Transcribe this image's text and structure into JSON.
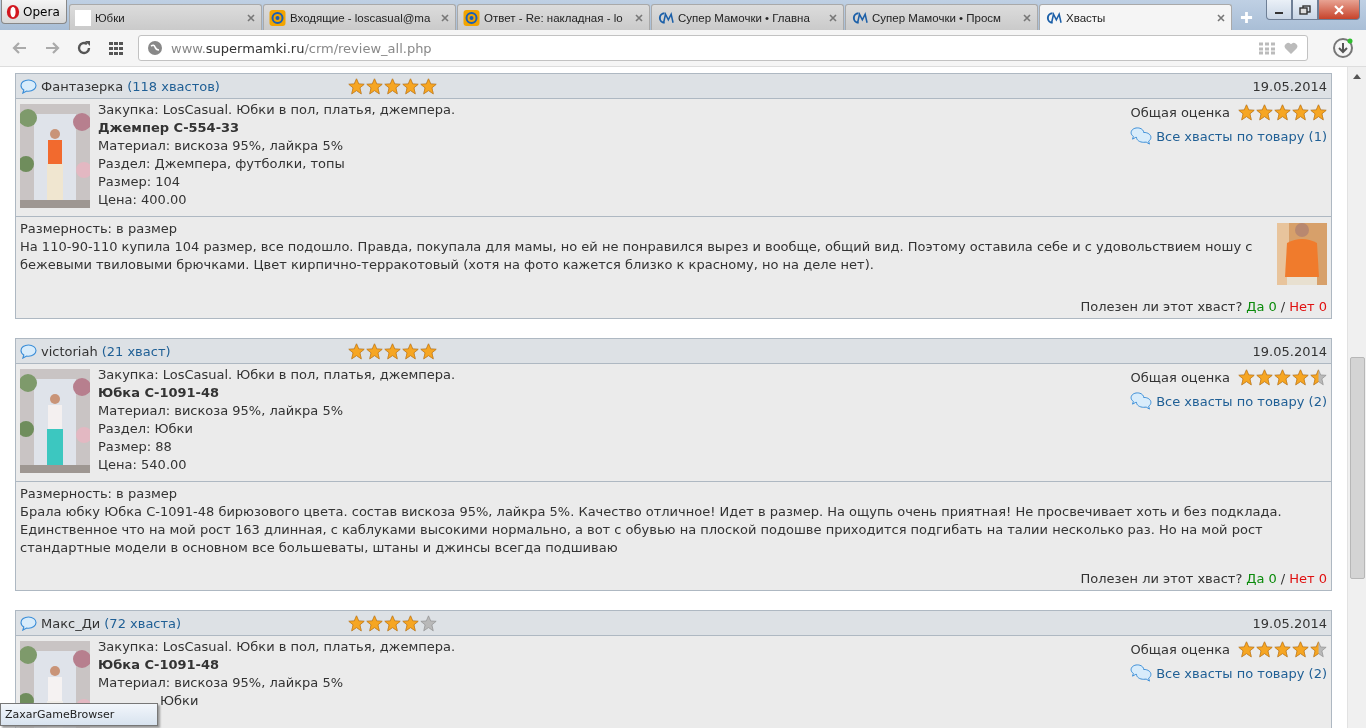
{
  "browser": {
    "menu_button": "Opera",
    "tabs": [
      {
        "title": "Юбки",
        "kind": "blank",
        "selected": false
      },
      {
        "title": "Входящие - loscasual@ma",
        "kind": "mail",
        "selected": false
      },
      {
        "title": "Ответ - Re: накладная - lo",
        "kind": "mail",
        "selected": false
      },
      {
        "title": "Супер Мамочки • Главна",
        "kind": "site",
        "selected": false
      },
      {
        "title": "Супер Мамочки • Просм",
        "kind": "site",
        "selected": false
      },
      {
        "title": "Хвасты",
        "kind": "site",
        "selected": true
      }
    ],
    "address": {
      "prefix": "www.",
      "host": "supermamki.ru",
      "path": "/crm/review_all.php"
    }
  },
  "reviews": [
    {
      "author": "Фантазерка",
      "count": "(118 хвастов)",
      "stars": 5,
      "date": "19.05.2014",
      "lines": [
        {
          "kind": "plain",
          "text": "Закупка: LosCasual. Юбки в пол, платья, джемпера."
        },
        {
          "kind": "title",
          "text": "Джемпер С-554-33"
        },
        {
          "kind": "plain",
          "text": "Материал: вискоза 95%, лайкра 5%"
        },
        {
          "kind": "plain",
          "text": "Раздел: Джемпера, футболки, топы"
        },
        {
          "kind": "plain",
          "text": "Размер: 104"
        },
        {
          "kind": "plain",
          "text": "Цена: 400.00"
        }
      ],
      "overall": {
        "label": "Общая оценка",
        "stars": 5
      },
      "all_link": "Все хвасты по товару (1)",
      "fit": "Размерность: в размер",
      "text": "На 110-90-110 купила 104 размер, все подошло. Правда, покупала для мамы, но ей не понравился вырез и вообще, общий вид. Поэтому оставила себе и с удовольствием ношу с бежевыми твиловыми брючками. Цвет кирпично-терракотовый (хотя на фото кажется близко к красному, но на деле нет).",
      "useful_question": "Полезен ли этот хваст?",
      "yes": "Да 0",
      "separator": "/",
      "no": "Нет 0"
    },
    {
      "author": "victoriah",
      "count": "(21 хваст)",
      "stars": 5,
      "date": "19.05.2014",
      "lines": [
        {
          "kind": "plain",
          "text": "Закупка: LosCasual. Юбки в пол, платья, джемпера."
        },
        {
          "kind": "title",
          "text": "Юбка С-1091-48"
        },
        {
          "kind": "plain",
          "text": "Материал: вискоза 95%, лайкра 5%"
        },
        {
          "kind": "plain",
          "text": "Раздел: Юбки"
        },
        {
          "kind": "plain",
          "text": "Размер: 88"
        },
        {
          "kind": "plain",
          "text": "Цена: 540.00"
        }
      ],
      "overall": {
        "label": "Общая оценка",
        "stars": 4.5
      },
      "all_link": "Все хвасты по товару (2)",
      "fit": "Размерность: в размер",
      "text": "Брала юбку Юбка С-1091-48 бирюзового цвета. состав вискоза 95%, лайкра 5%. Качество отличное! Идет в размер. На ощупь очень приятная! Не просвечивает хоть и без подклада. Единственное что на мой рост 163 длинная, с каблуками высокими нормально, а вот с обувью на плоской подошве приходится подгибать на талии несколько раз. Но на мой рост стандартные модели в основном все большеваты, штаны и джинсы всегда подшиваю",
      "useful_question": "Полезен ли этот хваст?",
      "yes": "Да 0",
      "separator": "/",
      "no": "Нет 0"
    },
    {
      "author": "Макс_Ди",
      "count": "(72 хваста)",
      "stars": 4,
      "date": "19.05.2014",
      "lines": [
        {
          "kind": "plain",
          "text": "Закупка: LosCasual. Юбки в пол, платья, джемпера."
        },
        {
          "kind": "title",
          "text": "Юбка С-1091-48"
        },
        {
          "kind": "plain",
          "text": "Материал: вискоза 95%, лайкра 5%"
        },
        {
          "kind": "covered",
          "text": "Юбки"
        }
      ],
      "overall": {
        "label": "Общая оценка",
        "stars": 4.5
      },
      "all_link": "Все хвасты по товару (2)"
    }
  ],
  "tooltip": "ZaxarGameBrowser"
}
